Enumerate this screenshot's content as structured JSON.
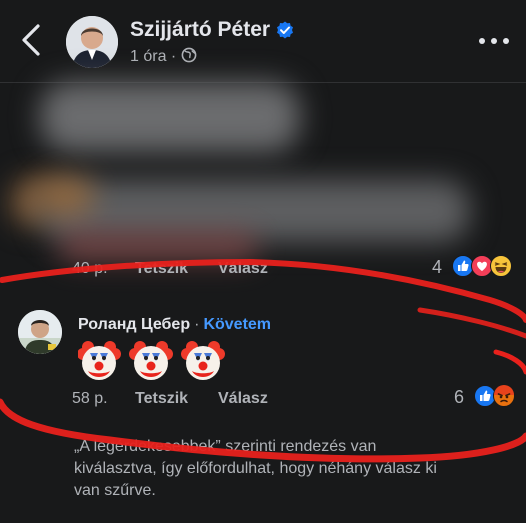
{
  "header": {
    "page_name": "Szijjártó Péter",
    "time": "1 óra",
    "separator": "·"
  },
  "comment1": {
    "time": "40 p.",
    "like": "Tetszik",
    "reply": "Válasz",
    "reaction_count": "4"
  },
  "comment2": {
    "author": "Роланд Цебер",
    "separator": "·",
    "follow": "Követem",
    "time": "58 p.",
    "like": "Tetszik",
    "reply": "Válasz",
    "reaction_count": "6"
  },
  "footer": {
    "line1": "„A legérdekesebbek” szerinti rendezés van",
    "line2": "kiválasztva, így előfordulhat, hogy néhány válasz ki",
    "line3": "van szűrve."
  },
  "colors": {
    "background": "#18191a",
    "accent": "#4599ff",
    "annotation_red": "#e8211c",
    "like_blue": "#1877f2",
    "love_red": "#f33e58"
  },
  "icons": [
    "back-arrow-icon",
    "verified-badge-icon",
    "globe-icon",
    "more-icon",
    "like-reaction-icon",
    "love-reaction-icon",
    "haha-reaction-icon",
    "angry-reaction-icon",
    "clown-emoji-icon"
  ]
}
